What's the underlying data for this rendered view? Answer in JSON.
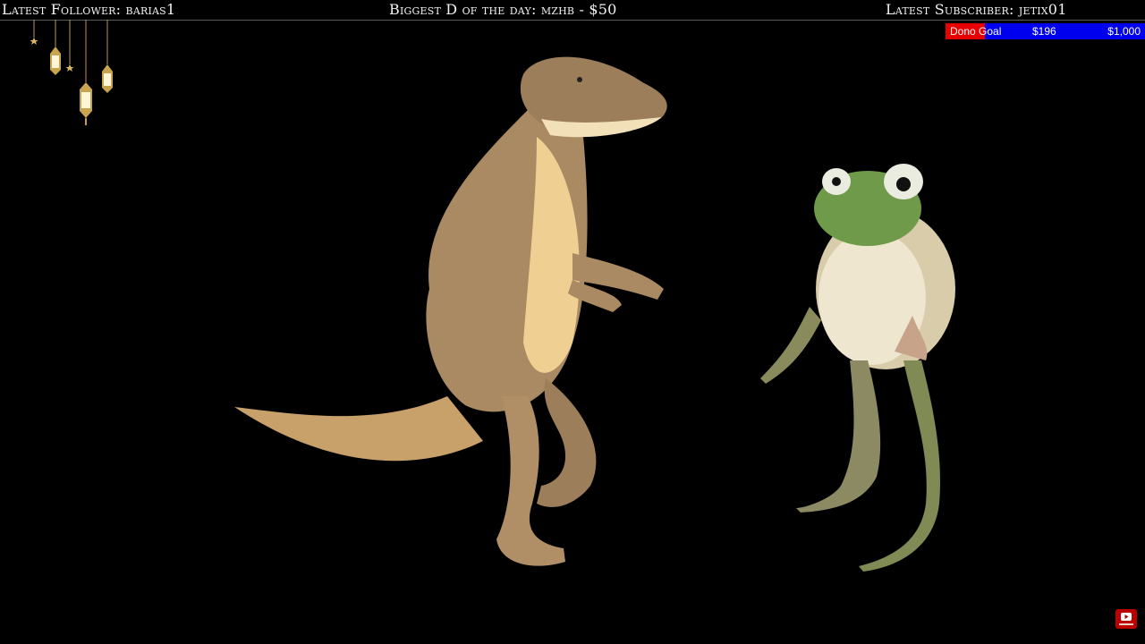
{
  "overlay": {
    "latest_follower": "Latest Follower: barias1",
    "biggest_donation": "Biggest D of the day: mzhb - $50",
    "latest_subscriber": "Latest Subscriber: jetix01"
  },
  "donation_goal": {
    "label": "Dono Goal",
    "current": "$196",
    "target": "$1,000",
    "progress_fraction": 0.196,
    "fill_color": "#e60000",
    "bar_color": "#0000ee"
  },
  "decorations": {
    "lanterns_icon": "hanging-lanterns",
    "subscribe_icon": "youtube-subscribe"
  },
  "scene": {
    "characters": [
      "dinosaur",
      "frog"
    ]
  }
}
